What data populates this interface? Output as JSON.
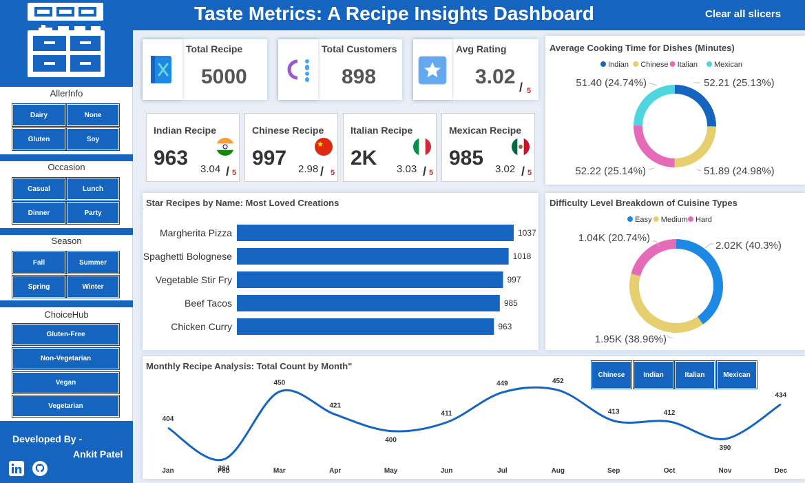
{
  "header": {
    "title": "Taste Metrics: A Recipe Insights Dashboard",
    "clear_label": "Clear all slicers"
  },
  "sidebar": {
    "groups": [
      {
        "title": "AllerInfo",
        "options": [
          "Dairy",
          "None",
          "Gluten",
          "Soy"
        ]
      },
      {
        "title": "Occasion",
        "options": [
          "Casual",
          "Lunch",
          "Dinner",
          "Party"
        ]
      },
      {
        "title": "Season",
        "options": [
          "Fall",
          "Summer",
          "Spring",
          "Winter"
        ]
      },
      {
        "title": "ChoiceHub",
        "options": [
          "Gluten-Free",
          "Non-Vegetarian",
          "Vegan",
          "Vegetarian"
        ]
      }
    ],
    "developer": {
      "label": "Developed By -",
      "name": "Ankit Patel"
    }
  },
  "kpis": {
    "total_recipe": {
      "label": "Total Recipe",
      "value": "5000"
    },
    "total_customers": {
      "label": "Total Customers",
      "value": "898"
    },
    "avg_rating": {
      "label": "Avg Rating",
      "value": "3.02",
      "slash": "/",
      "max": "5"
    }
  },
  "cuisines": [
    {
      "label": "Indian Recipe",
      "value": "963",
      "rating": "3.04",
      "slash": "/",
      "max": "5"
    },
    {
      "label": "Chinese Recipe",
      "value": "997",
      "rating": "2.98",
      "slash": "/",
      "max": "5"
    },
    {
      "label": "Italian Recipe",
      "value": "2K",
      "rating": "3.03",
      "slash": "/",
      "max": "5"
    },
    {
      "label": "Mexican Recipe",
      "value": "985",
      "rating": "3.02",
      "slash": "/",
      "max": "5"
    }
  ],
  "colors": {
    "primary": "#1565c0",
    "indian": "#1565c0",
    "chinese": "#e6cf6f",
    "italian": "#e56bb8",
    "mexican": "#4dd6e0",
    "easy": "#1e88e5",
    "medium": "#e6cf6f",
    "hard": "#e56bb8",
    "bar": "#1565c0",
    "line": "#1565c0",
    "accent_red": "#c62828"
  },
  "cooking_chart": {
    "title": "Average Cooking Time for Dishes (Minutes)",
    "legend": [
      "Indian",
      "Chinese",
      "Italian",
      "Mexican"
    ],
    "labels": [
      "52.21 (25.13%)",
      "51.89 (24.98%)",
      "52.22 (25.14%)",
      "51.40 (24.74%)"
    ]
  },
  "difficulty_chart": {
    "title": "Difficulty Level Breakdown of Cuisine Types",
    "legend": [
      "Easy",
      "Medium",
      "Hard"
    ],
    "labels": [
      "2.02K (40.3%)",
      "1.95K (38.96%)",
      "1.04K (20.74%)"
    ]
  },
  "bar_chart": {
    "title": "Star Recipes by Name: Most Loved Creations"
  },
  "line_chart": {
    "title": "Monthly Recipe Analysis: Total Count by Month\"",
    "filters": [
      "Chinese",
      "Indian",
      "Italian",
      "Mexican"
    ]
  },
  "chart_data": [
    {
      "type": "pie",
      "title": "Average Cooking Time for Dishes (Minutes)",
      "categories": [
        "Indian",
        "Chinese",
        "Italian",
        "Mexican"
      ],
      "values": [
        52.21,
        51.89,
        52.22,
        51.4
      ],
      "percents": [
        25.13,
        24.98,
        25.14,
        24.74
      ],
      "legend_position": "top"
    },
    {
      "type": "bar",
      "title": "Star Recipes by Name: Most Loved Creations",
      "categories": [
        "Margherita Pizza",
        "Spaghetti Bolognese",
        "Vegetable Stir Fry",
        "Beef Tacos",
        "Chicken Curry"
      ],
      "values": [
        1037,
        1018,
        997,
        985,
        963
      ],
      "orientation": "horizontal",
      "xlim": [
        0,
        1037
      ]
    },
    {
      "type": "pie",
      "title": "Difficulty Level Breakdown of Cuisine Types",
      "categories": [
        "Easy",
        "Medium",
        "Hard"
      ],
      "values": [
        2020,
        1950,
        1040
      ],
      "percents": [
        40.3,
        38.96,
        20.74
      ],
      "legend_position": "top"
    },
    {
      "type": "line",
      "title": "Monthly Recipe Analysis: Total Count by Month\"",
      "x": [
        "Jan",
        "Feb",
        "Mar",
        "Apr",
        "May",
        "Jun",
        "Jul",
        "Aug",
        "Sep",
        "Oct",
        "Nov",
        "Dec"
      ],
      "values": [
        404,
        364,
        450,
        421,
        400,
        411,
        449,
        452,
        413,
        412,
        390,
        434
      ],
      "ylim": [
        355,
        460
      ],
      "grid": false
    }
  ]
}
